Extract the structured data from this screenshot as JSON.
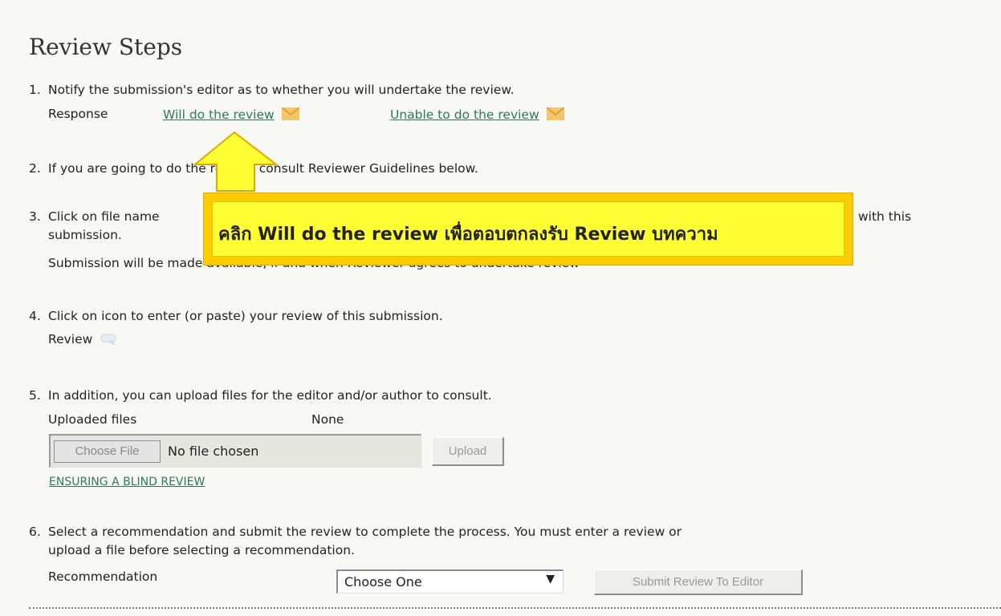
{
  "page": {
    "title": "Review Steps"
  },
  "steps": [
    {
      "num": "1.",
      "text": "Notify the submission's editor as to whether you will undertake the review.",
      "response_label": "Response",
      "will_do_link": "Will do the review",
      "unable_link": "Unable to do the review"
    },
    {
      "num": "2.",
      "text": "If you are going to do the review, consult Reviewer Guidelines below."
    },
    {
      "num": "3.",
      "text_start": "Click on file name",
      "text_end": "with this",
      "text_line2": "submission.",
      "text_line3": "Submission will be made available, if and when Reviewer agrees to undertake review"
    },
    {
      "num": "4.",
      "text": "Click on icon to enter (or paste) your review of this submission.",
      "review_label": "Review"
    },
    {
      "num": "5.",
      "text": "In addition, you can upload files for the editor and/or author to consult.",
      "uploaded_label": "Uploaded files",
      "uploaded_value": "None",
      "choose_file": "Choose File",
      "no_file": "No file chosen",
      "upload_button": "Upload",
      "blind_review_link": "ENSURING A BLIND REVIEW"
    },
    {
      "num": "6.",
      "text_line1": "Select a recommendation and submit the review to complete the process. You must enter a review or",
      "text_line2": "upload a file before selecting a recommendation.",
      "recommendation_label": "Recommendation",
      "select_value": "Choose One",
      "submit_button": "Submit Review To Editor"
    }
  ],
  "callout": {
    "text": "คลิก Will do the review เพื่อตอบตกลงรับ Review บทความ"
  },
  "icons": {
    "mail": "envelope-icon",
    "review": "speech-bubble-icon",
    "annotation": "arrow-up-icon"
  },
  "colors": {
    "link": "#2f7a5a",
    "callout_fill": "#ffff33",
    "callout_border": "#ffcc00",
    "arrow": "#ffcc00"
  }
}
